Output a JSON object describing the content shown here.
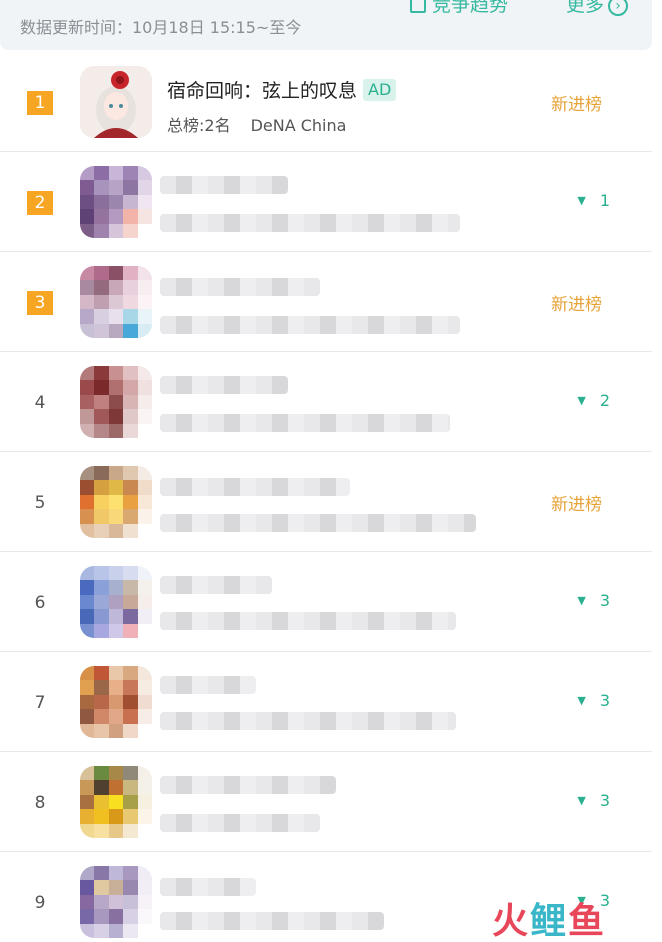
{
  "header": {
    "update_label": "数据更新时间：10月18日 15:15~至今",
    "trend_label": "竞争趋势",
    "more_label": "更多"
  },
  "rows": [
    {
      "rank": "1",
      "top": true,
      "name": "宿命回响：弦上的叹息",
      "ad": "AD",
      "meta": "总榜:2名",
      "developer": "DeNA China",
      "status": "新进榜",
      "status_type": "new"
    },
    {
      "rank": "2",
      "top": true,
      "status": "1",
      "status_type": "up"
    },
    {
      "rank": "3",
      "top": true,
      "status": "新进榜",
      "status_type": "new"
    },
    {
      "rank": "4",
      "top": false,
      "status": "2",
      "status_type": "up"
    },
    {
      "rank": "5",
      "top": false,
      "status": "新进榜",
      "status_type": "new"
    },
    {
      "rank": "6",
      "top": false,
      "status": "3",
      "status_type": "up"
    },
    {
      "rank": "7",
      "top": false,
      "status": "3",
      "status_type": "up"
    },
    {
      "rank": "8",
      "top": false,
      "status": "3",
      "status_type": "up"
    },
    {
      "rank": "9",
      "top": false,
      "status": "3",
      "status_type": "up"
    }
  ],
  "colors": {
    "accent": "#2bb08f",
    "rank_badge": "#f6a623",
    "new_entry": "#e7a33a"
  },
  "watermark": {
    "part1": "火",
    "part2": "鲤",
    "part3": "鱼"
  }
}
